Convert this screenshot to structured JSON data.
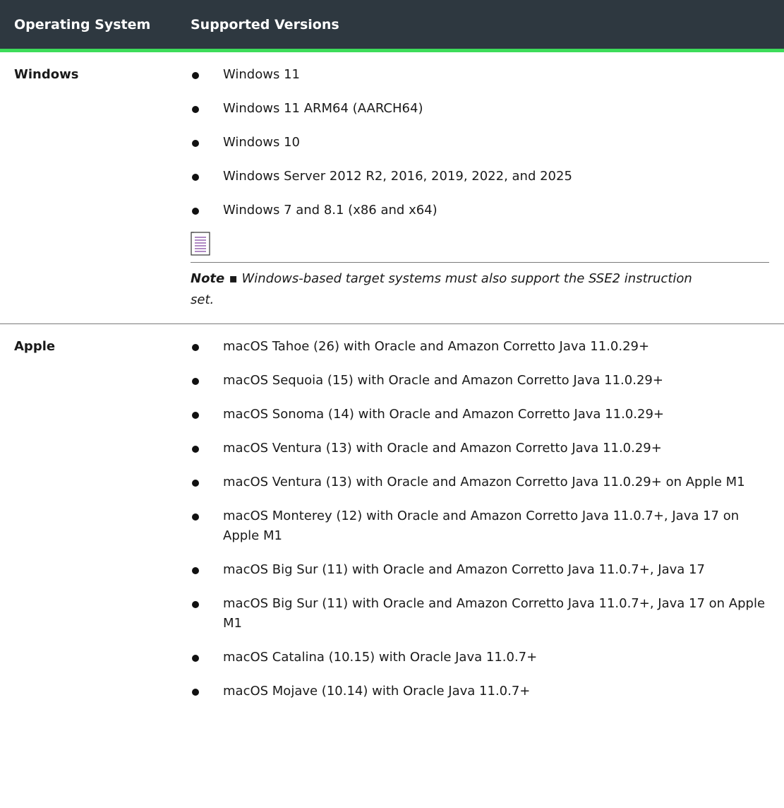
{
  "header": {
    "os_label": "Operating System",
    "versions_label": "Supported Versions"
  },
  "windows": {
    "name": "Windows",
    "versions": [
      "Windows 11",
      "Windows 11 ARM64 (AARCH64)",
      "Windows 10",
      "Windows Server 2012 R2, 2016, 2019, 2022, and 2025",
      "Windows 7 and 8.1 (x86 and x64)"
    ],
    "note": {
      "icon": "note-icon",
      "label": "Note ▪",
      "text": "Windows-based target systems must also support the SSE2 instruction set."
    }
  },
  "apple": {
    "name": "Apple",
    "versions": [
      "macOS Tahoe (26) with Oracle and Amazon Corretto Java 11.0.29+",
      "macOS Sequoia (15) with Oracle and Amazon Corretto Java 11.0.29+",
      "macOS Sonoma (14) with Oracle and Amazon Corretto Java 11.0.29+",
      "macOS Ventura (13) with Oracle and Amazon Corretto Java 11.0.29+",
      "macOS Ventura (13) with Oracle and Amazon Corretto Java 11.0.29+ on Apple M1",
      "macOS Monterey (12) with Oracle and Amazon Corretto Java 11.0.7+, Java 17 on Apple M1",
      "macOS Big Sur (11) with Oracle and Amazon Corretto Java 11.0.7+, Java 17",
      "macOS Big Sur (11) with Oracle and Amazon Corretto Java 11.0.7+, Java 17 on Apple M1",
      "macOS Catalina (10.15) with Oracle Java 11.0.7+",
      "macOS Mojave (10.14) with Oracle Java 11.0.7+"
    ]
  },
  "colors": {
    "header_bg": "#2e3840",
    "header_accent": "#3ddc5a",
    "note_icon": "#7a3b9c"
  }
}
